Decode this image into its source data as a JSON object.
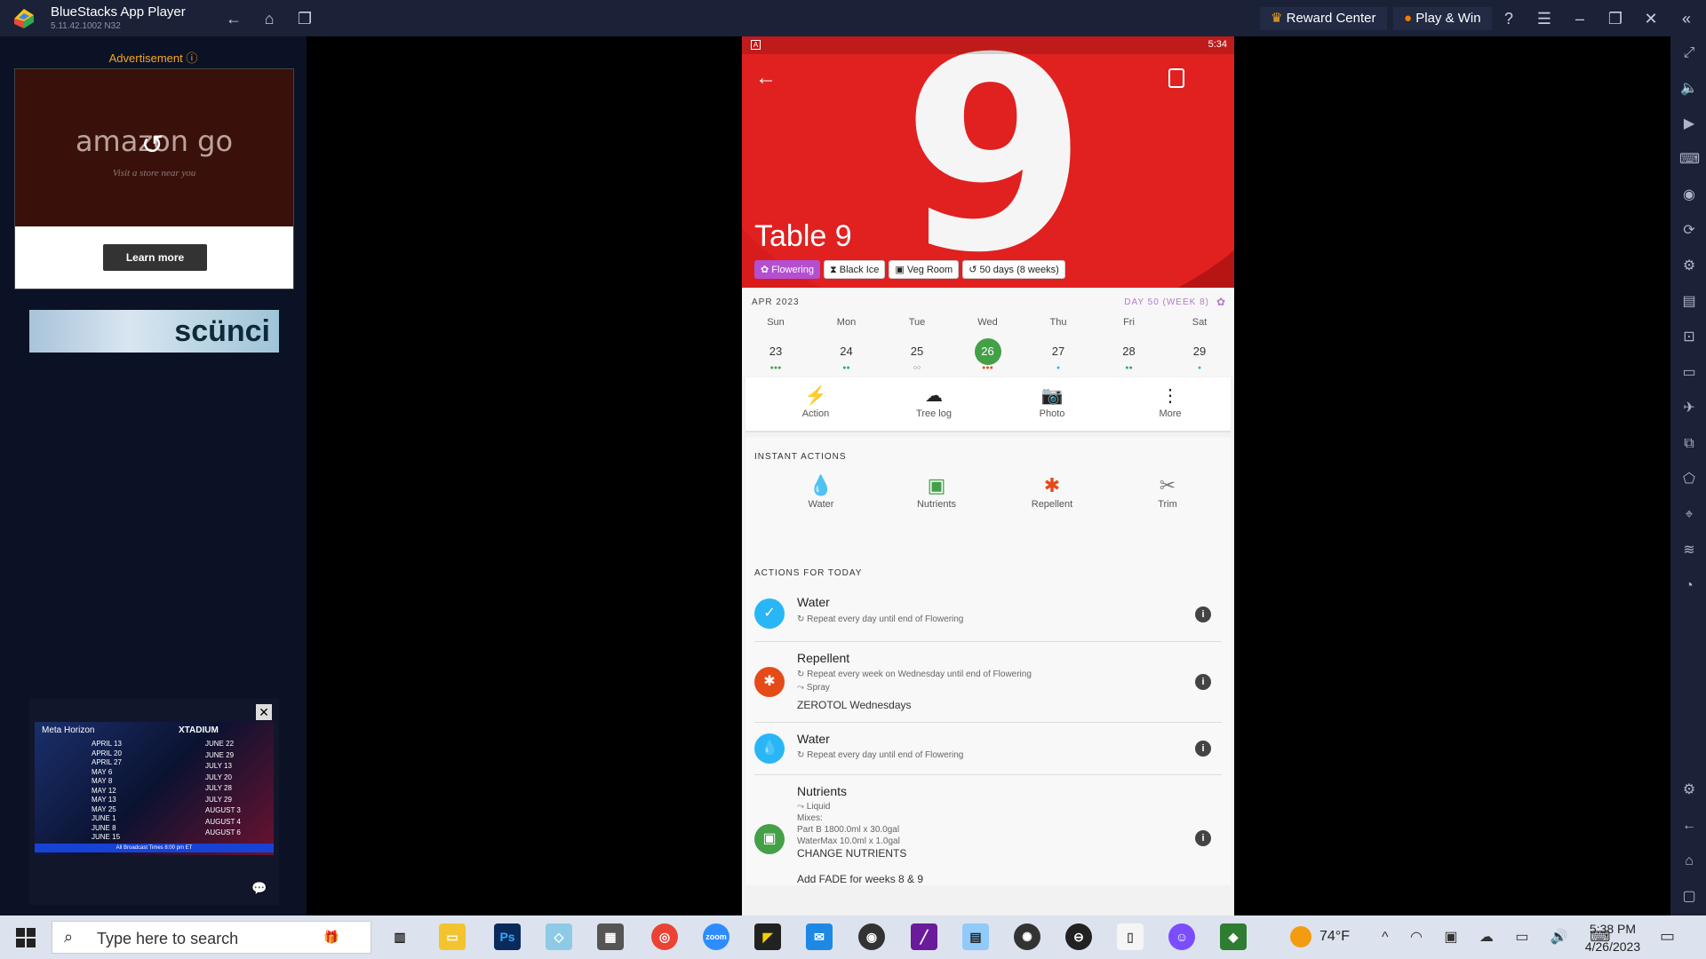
{
  "window": {
    "title": "BlueStacks App Player",
    "version": "5.11.42.1002  N32"
  },
  "titlebar": {
    "reward_center": "Reward Center",
    "play_win": "Play & Win"
  },
  "sidebar_ads": {
    "ad_label": "Advertisement",
    "brand": "amazon go",
    "tagline": "Visit a store near you",
    "cta": "Learn more",
    "banner_brand": "scünci",
    "video": {
      "left_logo": "Meta Horizon",
      "right_logo": "XTADIUM",
      "dates_left": [
        "APRIL 13",
        "APRIL 20",
        "APRIL 27",
        "MAY 6",
        "MAY 8",
        "MAY 12",
        "MAY 13",
        "MAY 25",
        "JUNE 1",
        "JUNE 8",
        "JUNE 15"
      ],
      "dates_right": [
        "JUNE 22",
        "JUNE 29",
        "JULY 13",
        "JULY 20",
        "JULY 28",
        "JULY 29",
        "AUGUST 3",
        "AUGUST 4",
        "AUGUST 6"
      ],
      "footer": "All Broadcast Times 8:00 pm ET"
    }
  },
  "phone": {
    "status_time": "5:34",
    "hero": {
      "number": "9",
      "title": "Table 9"
    },
    "chips": [
      "Flowering",
      "Black Ice",
      "Veg Room",
      "50 days (8 weeks)"
    ],
    "calendar": {
      "month": "APR 2023",
      "day_label": "DAY 50 (WEEK 8)",
      "days": [
        {
          "name": "Sun",
          "num": "23",
          "dots": "●●●",
          "dotcolor": "#43a047"
        },
        {
          "name": "Mon",
          "num": "24",
          "dots": "●●",
          "dotcolor": "#26a69a"
        },
        {
          "name": "Tue",
          "num": "25",
          "dots": "○○",
          "dotcolor": "#555555"
        },
        {
          "name": "Wed",
          "num": "26",
          "dots": "●●●",
          "dotcolor": "#e64a19"
        },
        {
          "name": "Thu",
          "num": "27",
          "dots": "●",
          "dotcolor": "#29b6f6"
        },
        {
          "name": "Fri",
          "num": "28",
          "dots": "●●",
          "dotcolor": "#26a69a"
        },
        {
          "name": "Sat",
          "num": "29",
          "dots": "●",
          "dotcolor": "#29b6f6"
        }
      ]
    },
    "action_bar": [
      {
        "label": "Action",
        "icon": "⚡"
      },
      {
        "label": "Tree log",
        "icon": "☁"
      },
      {
        "label": "Photo",
        "icon": "📷"
      },
      {
        "label": "More",
        "icon": "⋮"
      }
    ],
    "instant_actions": {
      "title": "INSTANT ACTIONS",
      "items": [
        {
          "label": "Water",
          "icon": "💧",
          "color": "#29b6f6"
        },
        {
          "label": "Nutrients",
          "icon": "▣",
          "color": "#43a047"
        },
        {
          "label": "Repellent",
          "icon": "✱",
          "color": "#e64a19"
        },
        {
          "label": "Trim",
          "icon": "✂",
          "color": "#777777"
        }
      ]
    },
    "today": {
      "title": "ACTIONS FOR TODAY",
      "tasks": [
        {
          "title": "Water",
          "sub1": "↻ Repeat every day until end of Flowering"
        },
        {
          "title": "Repellent",
          "sub1": "↻ Repeat every week on Wednesday until end of Flowering",
          "sub2": "Spray",
          "note": "ZEROTOL Wednesdays"
        },
        {
          "title": "Water",
          "sub1": "↻ Repeat every day until end of Flowering"
        },
        {
          "title": "Nutrients",
          "sub1": "Liquid",
          "sub2": "Mixes:",
          "sub3": "Part B 1800.0ml x 30.0gal",
          "sub4": "WaterMax 10.0ml x 1.0gal",
          "note": "CHANGE NUTRIENTS",
          "note2": "Add FADE for weeks 8 & 9"
        }
      ]
    }
  },
  "taskbar": {
    "search_placeholder": "Type here to search",
    "temperature": "74°F",
    "time": "5:38 PM",
    "date": "4/26/2023"
  },
  "colors": {
    "flowering": "#b34fd0",
    "selected_day": "#43a047",
    "water": "#29b6f6",
    "repellent": "#e64a19",
    "nutrients": "#43a047"
  }
}
